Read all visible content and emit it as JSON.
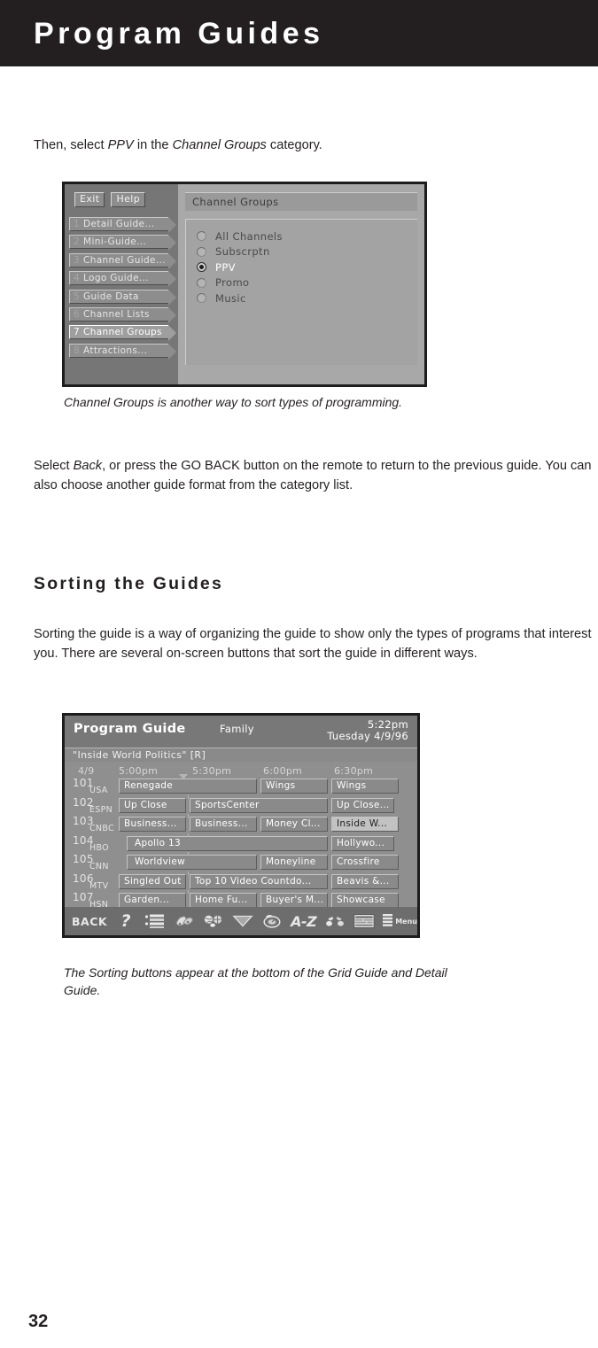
{
  "header": {
    "title": "Program Guides"
  },
  "intro": {
    "before": "Then, select ",
    "em1": "PPV",
    "mid": " in the ",
    "em2": "Channel Groups",
    "after": " category."
  },
  "caption1": "Channel Groups is another way to sort types of programming.",
  "body1": {
    "before": "Select ",
    "em1": "Back",
    "after": ", or press the GO BACK button on the remote to return to the previous guide. You can also choose another guide format from the category list."
  },
  "section": {
    "heading": "Sorting the Guides"
  },
  "body2": "Sorting the guide is a way of organizing the guide to show only the types of programs that interest you. There are several on-screen buttons that sort the guide in different ways.",
  "caption2": "The Sorting buttons appear at the bottom of the Grid Guide and Detail Guide.",
  "page_number": "32",
  "channel_groups_screen": {
    "buttons": [
      {
        "label": "Exit"
      },
      {
        "label": "Help"
      }
    ],
    "menu": [
      {
        "num": "1",
        "label": "Detail Guide...",
        "selected": false
      },
      {
        "num": "2",
        "label": "Mini-Guide...",
        "selected": false
      },
      {
        "num": "3",
        "label": "Channel Guide...",
        "selected": false
      },
      {
        "num": "4",
        "label": "Logo Guide...",
        "selected": false
      },
      {
        "num": "5",
        "label": "Guide Data",
        "selected": false
      },
      {
        "num": "6",
        "label": "Channel Lists",
        "selected": false
      },
      {
        "num": "7",
        "label": "Channel Groups",
        "selected": true
      },
      {
        "num": "8",
        "label": "Attractions...",
        "selected": false
      }
    ],
    "panel_title": "Channel Groups",
    "options": [
      {
        "label": "All Channels",
        "selected": false
      },
      {
        "label": "Subscrptn",
        "selected": false
      },
      {
        "label": "PPV",
        "selected": true
      },
      {
        "label": "Promo",
        "selected": false
      },
      {
        "label": "Music",
        "selected": false
      }
    ]
  },
  "program_guide_screen": {
    "title": "Program Guide",
    "category": "Family",
    "clock": "5:22pm",
    "date_line": "Tuesday 4/9/96",
    "info_bar": "\"Inside World Politics\" [R]",
    "date_col": "4/9",
    "time_slots": [
      "5:00pm",
      "5:30pm",
      "6:00pm",
      "6:30pm"
    ],
    "rows": [
      {
        "number": "101",
        "network": "USA",
        "cells": [
          {
            "label": "Renegade",
            "start": 0,
            "span": 2,
            "highlight": false,
            "arrow_left": false,
            "arrow_right": false
          },
          {
            "label": "Wings",
            "start": 2,
            "span": 1,
            "highlight": false,
            "arrow_left": false,
            "arrow_right": false
          },
          {
            "label": "Wings",
            "start": 3,
            "span": 1,
            "highlight": false,
            "arrow_left": false,
            "arrow_right": false
          }
        ]
      },
      {
        "number": "102",
        "network": "ESPN",
        "cells": [
          {
            "label": "Up Close",
            "start": 0,
            "span": 1,
            "highlight": false,
            "arrow_left": false,
            "arrow_right": false
          },
          {
            "label": "SportsCenter",
            "start": 1,
            "span": 2,
            "highlight": false,
            "arrow_left": false,
            "arrow_right": false
          },
          {
            "label": "Up Close...",
            "start": 3,
            "span": 1,
            "highlight": false,
            "arrow_left": false,
            "arrow_right": true
          }
        ]
      },
      {
        "number": "103",
        "network": "CNBC",
        "cells": [
          {
            "label": "Business...",
            "start": 0,
            "span": 1,
            "highlight": false,
            "arrow_left": false,
            "arrow_right": false
          },
          {
            "label": "Business...",
            "start": 1,
            "span": 1,
            "highlight": false,
            "arrow_left": false,
            "arrow_right": false
          },
          {
            "label": "Money Cl...",
            "start": 2,
            "span": 1,
            "highlight": false,
            "arrow_left": false,
            "arrow_right": false
          },
          {
            "label": "Inside W...",
            "start": 3,
            "span": 1,
            "highlight": true,
            "arrow_left": false,
            "arrow_right": false
          }
        ]
      },
      {
        "number": "104",
        "network": "HBO",
        "cells": [
          {
            "label": "Apollo 13",
            "start": 0,
            "span": 3,
            "highlight": false,
            "arrow_left": true,
            "arrow_right": false
          },
          {
            "label": "Hollywo...",
            "start": 3,
            "span": 1,
            "highlight": false,
            "arrow_left": false,
            "arrow_right": true
          }
        ]
      },
      {
        "number": "105",
        "network": "CNN",
        "cells": [
          {
            "label": "Worldview",
            "start": 0,
            "span": 2,
            "highlight": false,
            "arrow_left": true,
            "arrow_right": false
          },
          {
            "label": "Moneyline",
            "start": 2,
            "span": 1,
            "highlight": false,
            "arrow_left": false,
            "arrow_right": false
          },
          {
            "label": "Crossfire",
            "start": 3,
            "span": 1,
            "highlight": false,
            "arrow_left": false,
            "arrow_right": false
          }
        ]
      },
      {
        "number": "106",
        "network": "MTV",
        "cells": [
          {
            "label": "Singled Out",
            "start": 0,
            "span": 1,
            "highlight": false,
            "arrow_left": false,
            "arrow_right": false
          },
          {
            "label": "Top 10 Video Countdo...",
            "start": 1,
            "span": 2,
            "highlight": false,
            "arrow_left": false,
            "arrow_right": false
          },
          {
            "label": "Beavis &...",
            "start": 3,
            "span": 1,
            "highlight": false,
            "arrow_left": false,
            "arrow_right": false
          }
        ]
      },
      {
        "number": "107",
        "network": "HSN",
        "cells": [
          {
            "label": "Garden...",
            "start": 0,
            "span": 1,
            "highlight": false,
            "arrow_left": false,
            "arrow_right": false
          },
          {
            "label": "Home Fu...",
            "start": 1,
            "span": 1,
            "highlight": false,
            "arrow_left": false,
            "arrow_right": false
          },
          {
            "label": "Buyer's M...",
            "start": 2,
            "span": 1,
            "highlight": false,
            "arrow_left": false,
            "arrow_right": false
          },
          {
            "label": "Showcase",
            "start": 3,
            "span": 1,
            "highlight": false,
            "arrow_left": false,
            "arrow_right": false
          }
        ]
      }
    ],
    "toolbar": [
      {
        "icon": "back-label",
        "label": "BACK"
      },
      {
        "icon": "help-question-icon",
        "label": "?"
      },
      {
        "icon": "list-sort-icon",
        "label": ""
      },
      {
        "icon": "movies-icon",
        "label": ""
      },
      {
        "icon": "sports-icon",
        "label": ""
      },
      {
        "icon": "down-triangle-icon",
        "label": ""
      },
      {
        "icon": "time-sort-icon",
        "label": ""
      },
      {
        "icon": "alphabetical-sort-icon",
        "label": "A-Z"
      },
      {
        "icon": "binoculars-icon",
        "label": ""
      },
      {
        "icon": "grid-guide-icon",
        "label": ""
      },
      {
        "icon": "menu-icon",
        "label": "Menu"
      }
    ]
  }
}
